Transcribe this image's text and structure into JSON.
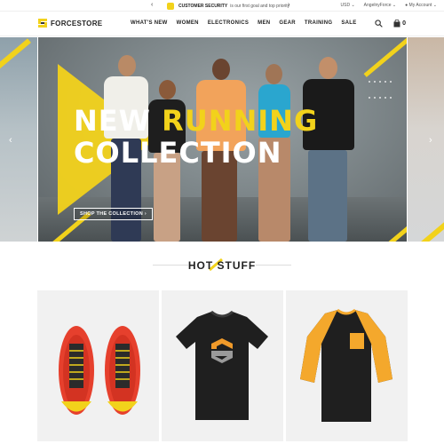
{
  "topbar": {
    "notice_bold": "CUSTOMER SECURITY",
    "notice_text": "is our first goal and top priority",
    "currency": "USD",
    "account_name": "AngelnyForce",
    "my_account": "My Account"
  },
  "header": {
    "brand": "FORCESTORE",
    "nav": [
      "WHAT'S NEW",
      "WOMEN",
      "ELECTRONICS",
      "MEN",
      "GEAR",
      "TRAINING",
      "SALE"
    ],
    "cart_count": "0"
  },
  "hero": {
    "title_line1_a": "NEW",
    "title_line1_b": "RUNNING",
    "title_line2": "COLLECTION",
    "cta": "SHOP THE COLLECTION"
  },
  "section": {
    "title": "HOT STUFF"
  },
  "products": [
    {
      "name": "red-running-shoes",
      "icon": "shoe-image"
    },
    {
      "name": "black-logo-tshirt",
      "icon": "tshirt-image"
    },
    {
      "name": "raglan-baseball-tee",
      "icon": "raglan-tee-image"
    }
  ],
  "colors": {
    "accent": "#f2d21b",
    "text": "#222222",
    "card_bg": "#f1f1f1"
  }
}
